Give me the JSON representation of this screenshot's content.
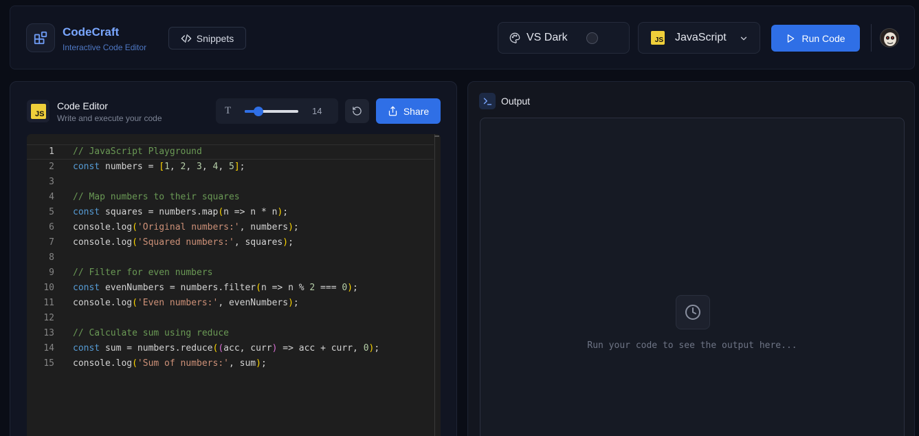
{
  "header": {
    "brand_title": "CodeCraft",
    "brand_subtitle": "Interactive Code Editor",
    "snippets_label": "Snippets",
    "theme_label": "VS Dark",
    "language_label": "JavaScript",
    "language_badge": "JS",
    "run_label": "Run Code"
  },
  "editor": {
    "title": "Code Editor",
    "subtitle": "Write and execute your code",
    "badge": "JS",
    "font_icon": "T",
    "font_size": "14",
    "font_size_fraction": 0.25,
    "share_label": "Share",
    "active_line": 1,
    "lines": [
      "// JavaScript Playground",
      "const numbers = [1, 2, 3, 4, 5];",
      "",
      "// Map numbers to their squares",
      "const squares = numbers.map(n => n * n);",
      "console.log('Original numbers:', numbers);",
      "console.log('Squared numbers:', squares);",
      "",
      "// Filter for even numbers",
      "const evenNumbers = numbers.filter(n => n % 2 === 0);",
      "console.log('Even numbers:', evenNumbers);",
      "",
      "// Calculate sum using reduce",
      "const sum = numbers.reduce((acc, curr) => acc + curr, 0);",
      "console.log('Sum of numbers:', sum);"
    ]
  },
  "output": {
    "title": "Output",
    "placeholder": "Run your code to see the output here..."
  },
  "icons": {
    "logo": "blocks-icon",
    "snippets": "code-icon",
    "theme": "palette-icon",
    "run": "play-icon",
    "reset": "rotate-ccw-icon",
    "share": "share-icon",
    "output": "terminal-icon",
    "empty_output": "clock-icon"
  },
  "colors": {
    "accent": "#2f6fe6",
    "brand": "#7aa7ff",
    "js_badge": "#f0cf3a"
  }
}
